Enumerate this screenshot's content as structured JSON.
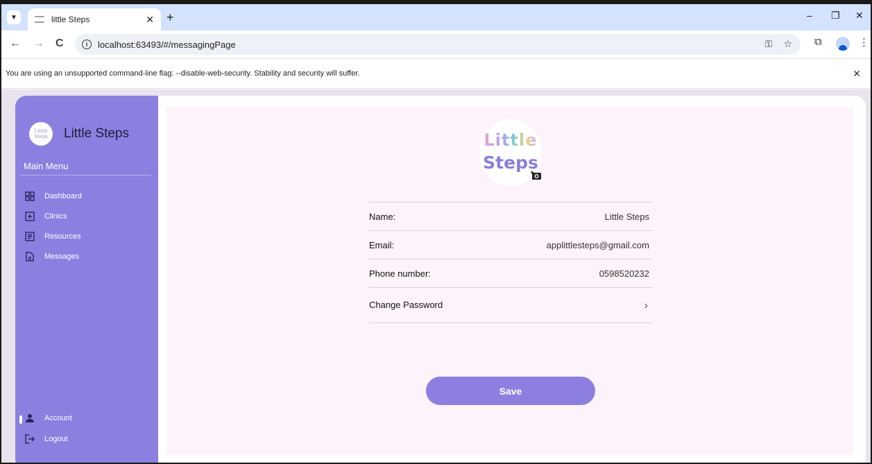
{
  "browser": {
    "tab_title": "little Steps",
    "tab_close": "✕",
    "new_tab": "+",
    "url": "localhost:63493/#/messagingPage",
    "back": "←",
    "forward": "→",
    "reload": "C",
    "minimize": "–",
    "restore": "❐",
    "close": "✕",
    "menu": "⋮",
    "infobar_text": "You are using an unsupported command-line flag: --disable-web-security. Stability and security will suffer.",
    "infobar_close": "✕"
  },
  "sidebar": {
    "brand_logo_line1": "Little",
    "brand_logo_line2": "Steps",
    "brand_name": "Little Steps",
    "section_title": "Main Menu",
    "items": [
      {
        "label": "Dashboard",
        "icon": "dashboard-icon"
      },
      {
        "label": "Clinics",
        "icon": "plus-box-icon"
      },
      {
        "label": "Resources",
        "icon": "list-icon"
      },
      {
        "label": "Messages",
        "icon": "document-icon"
      }
    ],
    "account_label": "Account",
    "logout_label": "Logout"
  },
  "profile": {
    "logo_line1": "Little",
    "logo_line2": "Steps",
    "fields": [
      {
        "label": "Name:",
        "value": "Little Steps"
      },
      {
        "label": "Email:",
        "value": "applittlesteps@gmail.com"
      },
      {
        "label": "Phone number:",
        "value": "0598520232"
      }
    ],
    "change_password_label": "Change Password",
    "chevron": "›",
    "save_label": "Save"
  },
  "colors": {
    "sidebar": "#8b80e0",
    "content_bg": "#fdf3fb",
    "button": "#8d7fe0",
    "tabstrip": "#d3e3fd"
  }
}
